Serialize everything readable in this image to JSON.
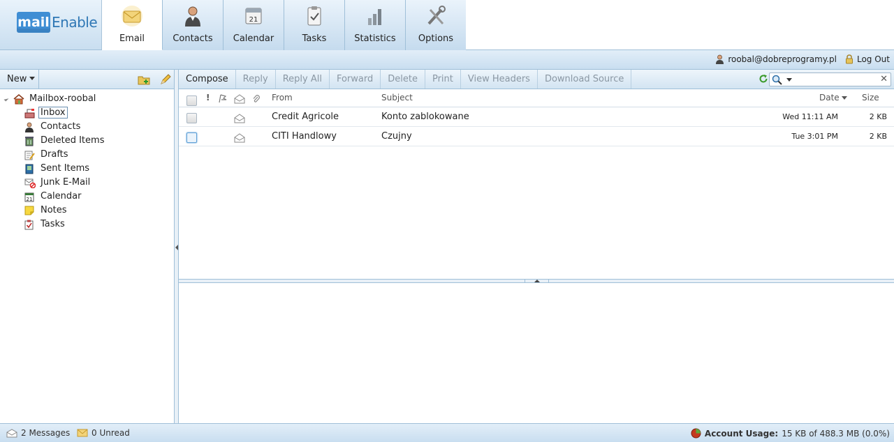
{
  "app": {
    "logo_prefix": "mail",
    "logo_word": "Enable"
  },
  "tabs": [
    {
      "label": "Email",
      "icon": "envelope-icon",
      "active": true
    },
    {
      "label": "Contacts",
      "icon": "contact-person-icon"
    },
    {
      "label": "Calendar",
      "icon": "calendar-icon"
    },
    {
      "label": "Tasks",
      "icon": "clipboard-icon"
    },
    {
      "label": "Statistics",
      "icon": "bar-chart-icon"
    },
    {
      "label": "Options",
      "icon": "tools-icon"
    }
  ],
  "account": {
    "user": "roobal@dobreprogramy.pl",
    "logout": "Log Out"
  },
  "left": {
    "new_label": "New",
    "root": "Mailbox-roobal",
    "folders": [
      {
        "label": "Inbox",
        "icon": "inbox-icon",
        "selected": true
      },
      {
        "label": "Contacts",
        "icon": "contacts-icon"
      },
      {
        "label": "Deleted Items",
        "icon": "trash-icon"
      },
      {
        "label": "Drafts",
        "icon": "drafts-icon"
      },
      {
        "label": "Sent Items",
        "icon": "sent-icon"
      },
      {
        "label": "Junk E-Mail",
        "icon": "junk-icon"
      },
      {
        "label": "Calendar",
        "icon": "calendar-icon"
      },
      {
        "label": "Notes",
        "icon": "notes-icon"
      },
      {
        "label": "Tasks",
        "icon": "tasks-icon"
      }
    ]
  },
  "toolbar": {
    "compose": "Compose",
    "reply": "Reply",
    "reply_all": "Reply All",
    "forward": "Forward",
    "delete": "Delete",
    "print": "Print",
    "view_headers": "View Headers",
    "download_source": "Download Source",
    "search_value": ""
  },
  "grid": {
    "columns": {
      "importance": "!",
      "from": "From",
      "subject": "Subject",
      "date": "Date",
      "size": "Size"
    },
    "rows": [
      {
        "from": "Credit Agricole",
        "subject": "Konto zablokowane",
        "date": "Wed 11:11 AM",
        "size": "2 KB"
      },
      {
        "from": "CITI Handlowy",
        "subject": "Czujny",
        "date": "Tue 3:01 PM",
        "size": "2 KB"
      }
    ]
  },
  "status": {
    "messages": "2 Messages",
    "unread": "0 Unread",
    "usage_label": "Account Usage:",
    "usage_value": "15 KB of 488.3 MB (0.0%)"
  },
  "colors": {
    "accent": "#3f8ed4",
    "border": "#9fbfd8",
    "disabled_text": "#8a97a3"
  }
}
